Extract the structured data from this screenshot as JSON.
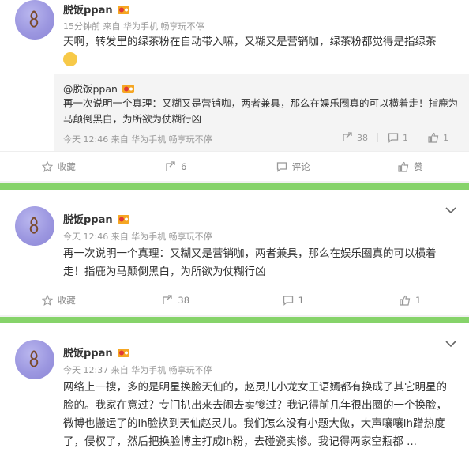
{
  "posts": [
    {
      "user": "脱饭ppan",
      "meta": "15分钟前 来自 华为手机 畅享玩不停",
      "content": "天啊，转发里的绿茶粉在自动带入嘛，又糊又是营销咖，绿茶粉都觉得是指绿茶",
      "retweet": {
        "user": "@脱饭ppan",
        "text": "再一次说明一个真理：又糊又是营销咖，两者兼具，那么在娱乐圈真的可以横着走！指鹿为马颠倒黑白，为所欲为仗糊行凶",
        "meta": "今天 12:46 来自 华为手机 畅享玩不停",
        "reposts": "38",
        "comments": "1",
        "likes": "1"
      },
      "actions": {
        "collect": "收藏",
        "repost": "6",
        "comment": "评论",
        "like": "赞"
      }
    },
    {
      "user": "脱饭ppan",
      "meta": "今天 12:46 来自 华为手机 畅享玩不停",
      "content": "再一次说明一个真理：又糊又是营销咖，两者兼具，那么在娱乐圈真的可以横着走！指鹿为马颠倒黑白，为所欲为仗糊行凶",
      "actions": {
        "collect": "收藏",
        "repost": "38",
        "comment": "1",
        "like": "1"
      }
    },
    {
      "user": "脱饭ppan",
      "meta": "今天 12:37 来自 华为手机 畅享玩不停",
      "content": "网络上一搜，多的是明星换脸天仙的，赵灵儿小龙女王语嫣都有换成了其它明星的脸的。我家在意过？专门扒出来去闹去卖惨过？我记得前几年很出圈的一个换脸，微博也搬运了的lh脸换到天仙赵灵儿。我们怎么没有小题大做，大声嚷嚷lh蹭热度了，侵权了，然后把换脸博主打成lh粉，去碰瓷卖惨。我记得两家空瓶都 ..."
    }
  ],
  "colors": {
    "accent_green": "#86d36a",
    "avatar": "#9c97e0",
    "vip_badge": "#f5a623"
  },
  "icons": [
    "vip-badge-icon",
    "chevron-down-icon",
    "star-icon",
    "repost-icon",
    "comment-icon",
    "like-icon",
    "emoji-icon"
  ]
}
